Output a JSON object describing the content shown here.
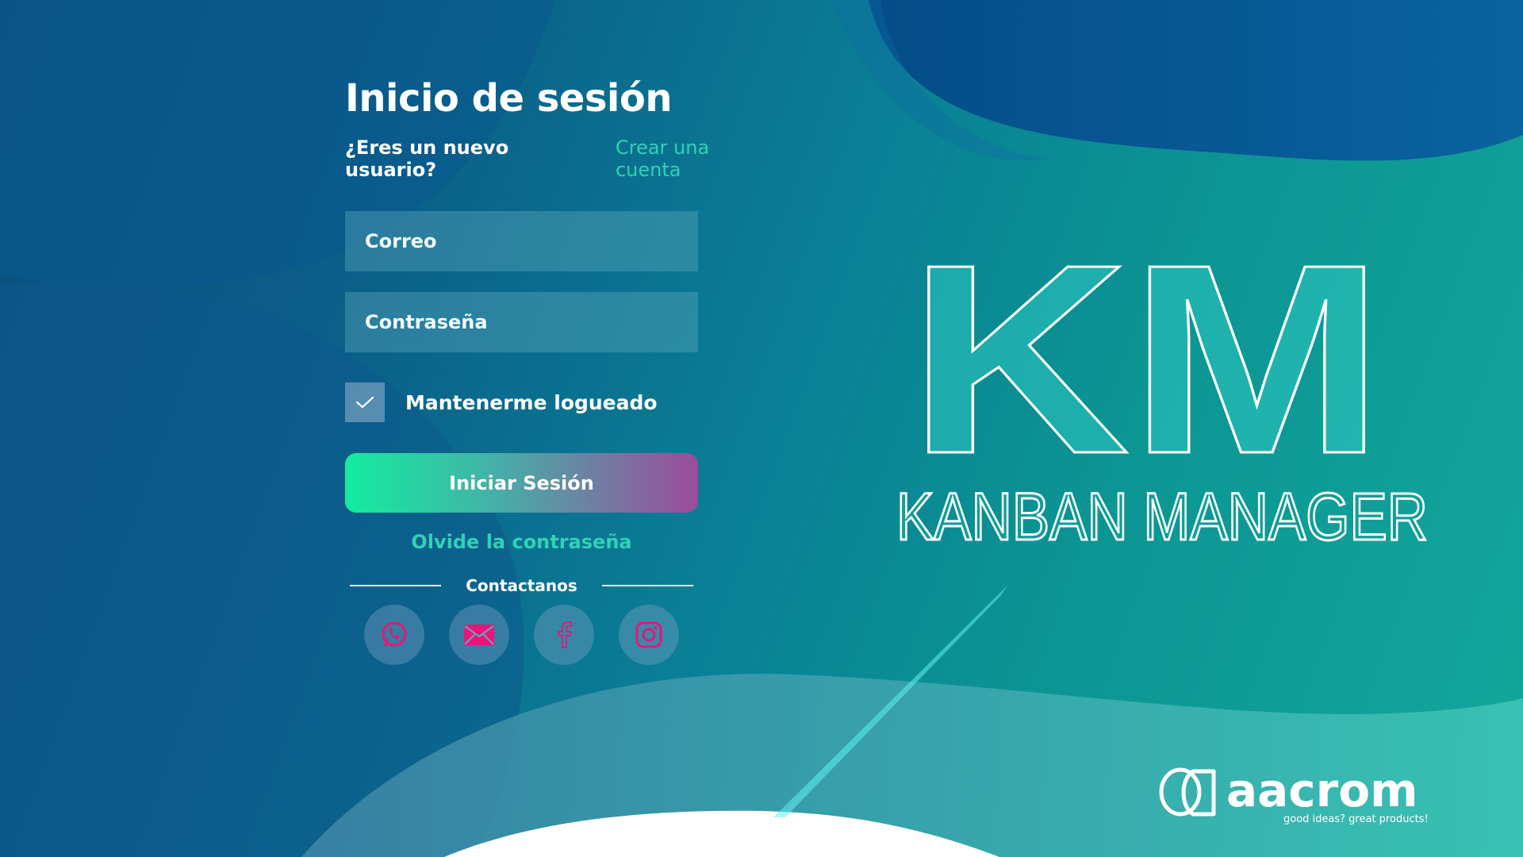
{
  "login": {
    "title": "Inicio de sesión",
    "new_user_question": "¿Eres un nuevo usuario?",
    "create_account_link": "Crear una cuenta",
    "email_placeholder": "Correo",
    "password_placeholder": "Contraseña",
    "remember_label": "Mantenerme logueado",
    "remember_checked": true,
    "submit_label": "Iniciar Sesión",
    "forgot_link": "Olvide la contraseña",
    "contact_label": "Contactanos"
  },
  "social": [
    {
      "name": "whatsapp-icon"
    },
    {
      "name": "mail-icon"
    },
    {
      "name": "facebook-icon"
    },
    {
      "name": "instagram-icon"
    }
  ],
  "logo": {
    "letters": "KM",
    "subtitle": "KANBAN MANAGER"
  },
  "brand": {
    "name": "aacrom",
    "tagline": "good ideas? great products!"
  },
  "colors": {
    "accent_teal": "#2fd2b5",
    "social_icon": "#e8157a",
    "button_start": "#14ec9e",
    "button_end": "#9b4c9c"
  }
}
